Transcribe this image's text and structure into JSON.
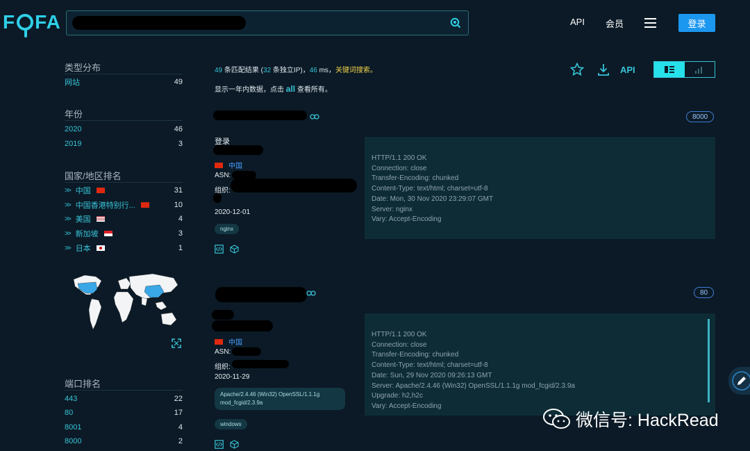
{
  "header": {
    "logo_text_left": "F",
    "logo_text_right": "FA",
    "search": {
      "value": "",
      "placeholder": ""
    },
    "nav": {
      "api": "API",
      "member": "会员",
      "login": "登录"
    }
  },
  "sidebar": {
    "type_section": {
      "title": "类型分布",
      "items": [
        {
          "label": "网站",
          "count": "49"
        }
      ]
    },
    "year_section": {
      "title": "年份",
      "items": [
        {
          "label": "2020",
          "count": "46"
        },
        {
          "label": "2019",
          "count": "3"
        }
      ]
    },
    "country_section": {
      "title": "国家/地区排名",
      "items": [
        {
          "label": "中国",
          "count": "31",
          "flag": "cn"
        },
        {
          "label": "中国香港特别行...",
          "count": "10",
          "flag": "hk"
        },
        {
          "label": "美国",
          "count": "4",
          "flag": "us"
        },
        {
          "label": "新加坡",
          "count": "3",
          "flag": "sg"
        },
        {
          "label": "日本",
          "count": "1",
          "flag": "jp"
        }
      ]
    },
    "port_section": {
      "title": "端口排名",
      "items": [
        {
          "label": "443",
          "count": "22"
        },
        {
          "label": "80",
          "count": "17"
        },
        {
          "label": "8001",
          "count": "4"
        },
        {
          "label": "8000",
          "count": "2"
        }
      ]
    }
  },
  "main": {
    "summary": {
      "count": "49",
      "count_suffix": " 条匹配结果 (",
      "ip_count": "32",
      "ip_suffix": " 条独立IP)，",
      "ms": "46",
      "ms_suffix": " ms，",
      "keyword": "关键词搜索。"
    },
    "year_note": {
      "prefix": "显示一年内数据，点击 ",
      "all": "all",
      "suffix": " 查看所有。"
    },
    "toolbar": {
      "api": "API"
    },
    "results": [
      {
        "port": "8000",
        "title": "登录",
        "country": "中国",
        "asn_label": "ASN:",
        "org_label": "组织:",
        "date": "2020-12-01",
        "tags": [
          "nginx"
        ],
        "headers": [
          "HTTP/1.1 200 OK",
          "Connection: close",
          "Transfer-Encoding: chunked",
          "Content-Type: text/html; charset=utf-8",
          "Date: Mon, 30 Nov 2020 23:29:07 GMT",
          "Server: nginx",
          "Vary: Accept-Encoding"
        ]
      },
      {
        "port": "80",
        "title": "",
        "country": "中国",
        "asn_label": "ASN:",
        "org_label": "组织:",
        "date": "2020-11-29",
        "tags": [
          "Apache/2.4.46 (Win32) OpenSSL/1.1.1g mod_fcgid/2.3.9a",
          "windows"
        ],
        "headers": [
          "HTTP/1.1 200 OK",
          "Connection: close",
          "Transfer-Encoding: chunked",
          "Content-Type: text/html; charset=utf-8",
          "Date: Sun, 29 Nov 2020 09:26:13 GMT",
          "Server: Apache/2.4.46 (Win32) OpenSSL/1.1.1g mod_fcgid/2.3.9a",
          "Upgrade: h2,h2c",
          "Vary: Accept-Encoding"
        ]
      }
    ]
  },
  "watermark": {
    "text": "微信号: HackRead"
  },
  "colors": {
    "accent": "#38c3d8",
    "background": "#0b1a26",
    "login": "#1c97f0",
    "keyword": "#f2d14b",
    "badge": "#3f7fd8"
  }
}
